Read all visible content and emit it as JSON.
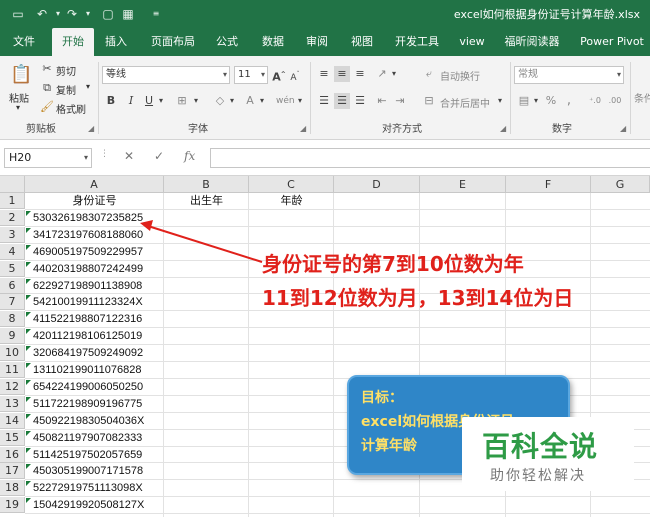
{
  "titlebar": {
    "title": "excel如何根据身份证号计算年龄.xlsx",
    "icons": [
      "save-icon",
      "undo-icon",
      "redo-icon",
      "print-preview-icon",
      "format-painter-icon",
      "customize-icon"
    ]
  },
  "tabs": [
    "文件",
    "开始",
    "插入",
    "页面布局",
    "公式",
    "数据",
    "审阅",
    "视图",
    "开发工具",
    "view",
    "福昕阅读器",
    "Power Pivot"
  ],
  "ribbon": {
    "clipboard": {
      "paste": "粘贴",
      "cut": "剪切",
      "copy": "复制",
      "painter": "格式刷",
      "label": "剪贴板"
    },
    "font": {
      "name": "等线",
      "size": "11",
      "grow": "A",
      "shrink": "A",
      "bold": "B",
      "italic": "I",
      "underline": "U",
      "label": "字体"
    },
    "alignment": {
      "wrap": "自动换行",
      "merge": "合并后居中",
      "label": "对齐方式"
    },
    "number": {
      "format": "常规",
      "label": "数字"
    },
    "more": "条件"
  },
  "formula_bar": {
    "name_box": "H20",
    "cancel": "✕",
    "enter": "✓",
    "fx": "fx",
    "value": ""
  },
  "grid": {
    "columns": [
      "A",
      "B",
      "C",
      "D",
      "E",
      "F",
      "G"
    ],
    "rows": [
      "1",
      "2",
      "3",
      "4",
      "5",
      "6",
      "7",
      "8",
      "9",
      "10",
      "11",
      "12",
      "13",
      "14",
      "15",
      "16",
      "17",
      "18",
      "19"
    ],
    "headers": {
      "a1": "身份证号",
      "b1": "出生年",
      "c1": "年龄"
    },
    "ids": [
      "530326198307235825",
      "341723197608188060",
      "469005197509229957",
      "440203198807242499",
      "622927198901138908",
      "54210019911123324X",
      "411522198807122316",
      "420112198106125019",
      "320684197509249092",
      "131102199011076828",
      "654224199006050250",
      "511722198909196775",
      "45092219830504036X",
      "450821197907082333",
      "511425197502057659",
      "450305199007171578",
      "52272919751113098X",
      "15042919920508127X"
    ]
  },
  "annotation": {
    "line1": "身份证号的第7到10位数为年",
    "line2": "11到12位数为月，13到14位为日",
    "color": "#e0211b"
  },
  "goal": {
    "line1": "目标：",
    "line2": "excel如何根据身份证号",
    "line3": "计算年龄"
  },
  "watermark": {
    "title": "百科全说",
    "subtitle": "助你轻松解决"
  }
}
